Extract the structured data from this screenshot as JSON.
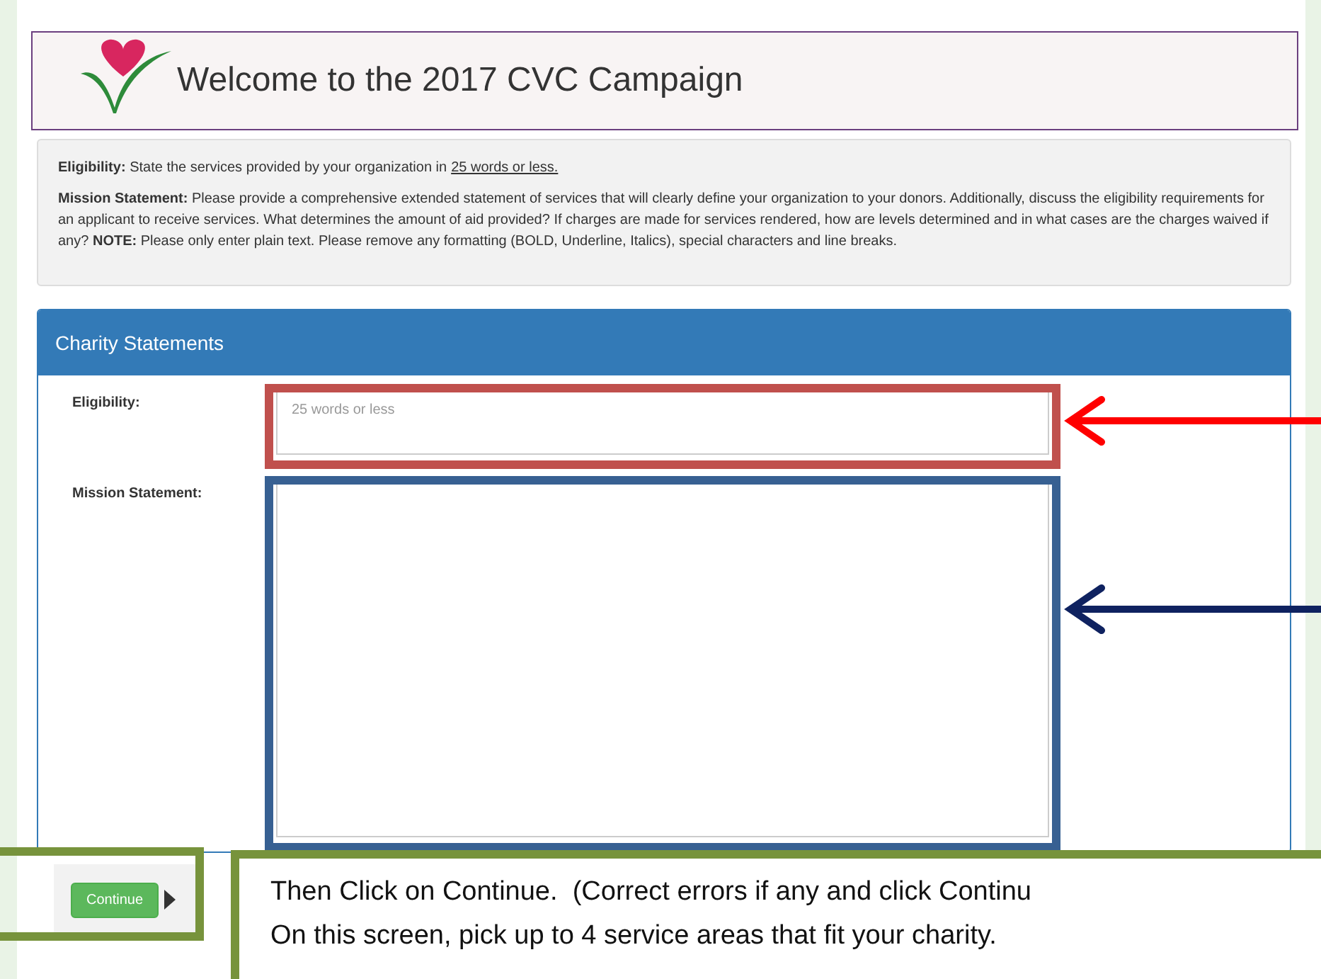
{
  "header": {
    "title": "Welcome to the 2017 CVC Campaign"
  },
  "instructions": [
    {
      "label": "Eligibility:",
      "text": "State the services provided by your organization in",
      "link": "25 words or less."
    },
    {
      "label": "Mission Statement:",
      "text": "Please provide a comprehensive extended statement of services that will clearly define your organization to your donors. Additionally, discuss the eligibility requirements for an applicant to receive services. What determines the amount of aid provided? If charges are made for services rendered, how are levels determined and in what cases are the charges waived if any? **NOTE:** Please only enter plain text. Please remove any formatting (BOLD, Underline, Italics), special characters and line breaks."
    }
  ],
  "panel": {
    "title": "Charity Statements",
    "fields": [
      {
        "kind": "single",
        "label": "Eligibility:",
        "placeholder": "25 words or less"
      },
      {
        "kind": "multi",
        "label": "Mission Statement:"
      }
    ]
  },
  "continue_button": "Continue",
  "callout": [
    "Then Click on Continue.  (Correct errors if any and click Continu",
    "On this screen, pick up to 4 service areas that fit your charity."
  ]
}
